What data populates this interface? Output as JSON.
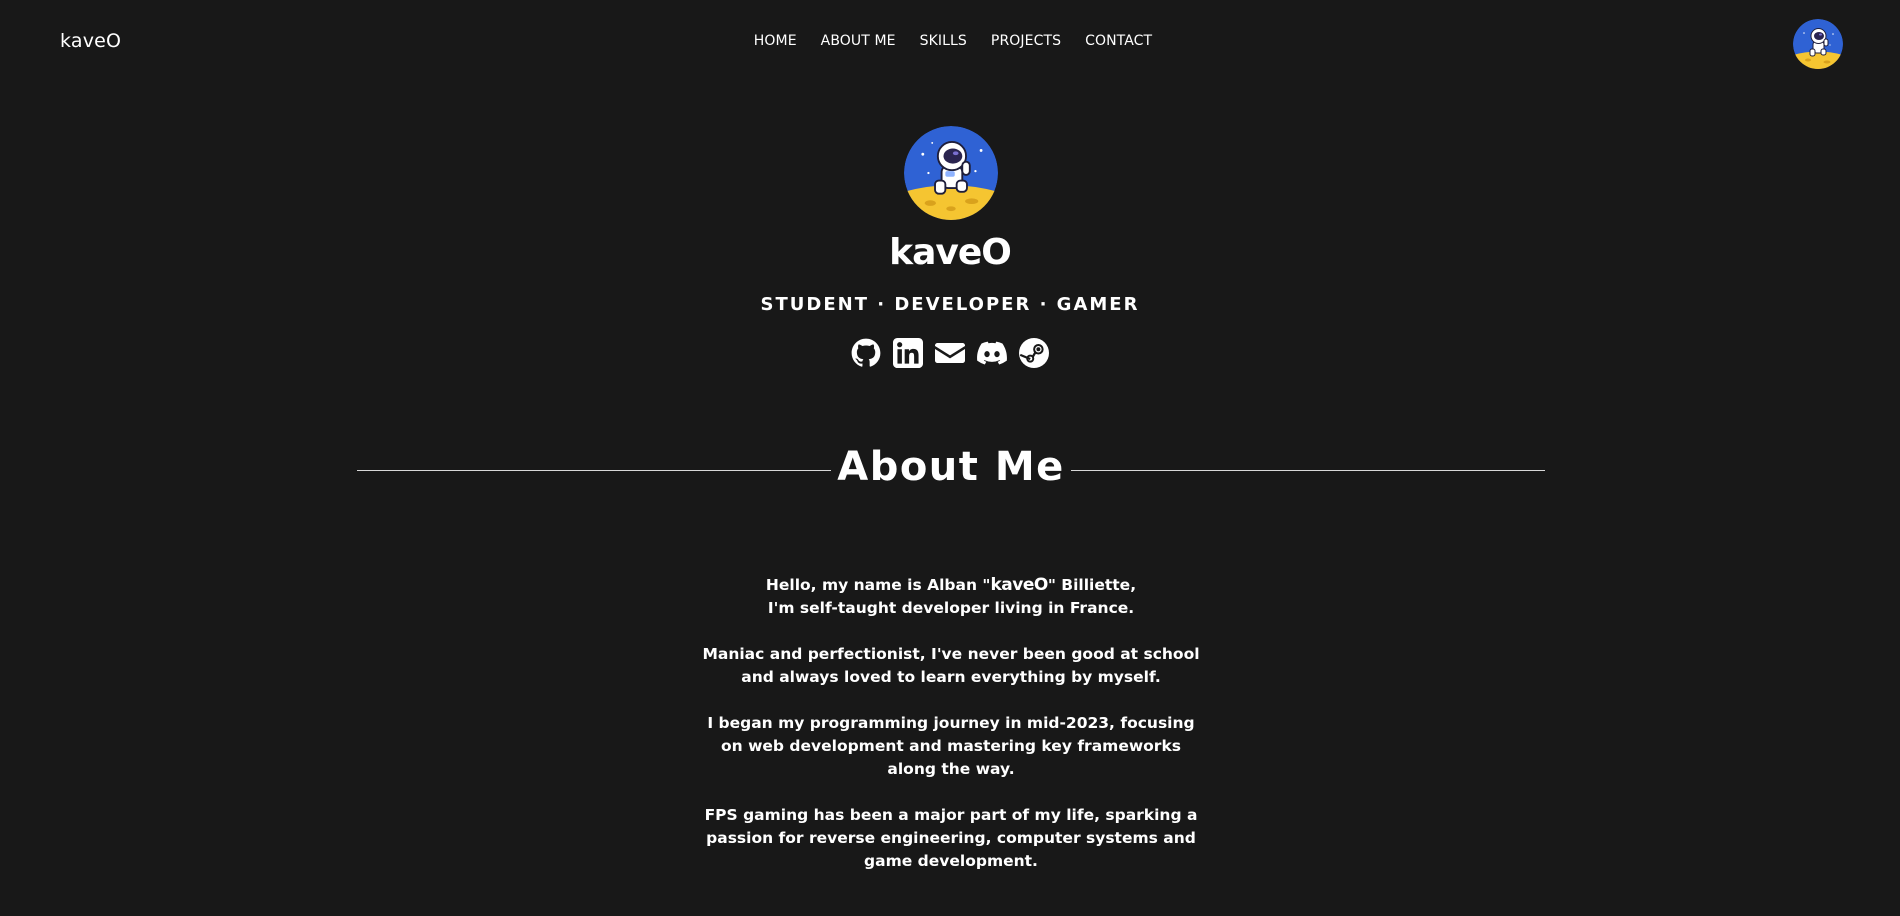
{
  "header": {
    "brand": "kaveO",
    "nav": [
      "HOME",
      "ABOUT ME",
      "SKILLS",
      "PROJECTS",
      "CONTACT"
    ],
    "avatar_icon": "astronaut-avatar-icon"
  },
  "hero": {
    "name": "kaveO",
    "tagline": "STUDENT · DEVELOPER · GAMER",
    "socials": [
      "github-icon",
      "linkedin-icon",
      "email-icon",
      "discord-icon",
      "steam-icon"
    ]
  },
  "about": {
    "title": "About Me",
    "p1_before": "Hello, my name is Alban \"",
    "p1_nick": "kaveO",
    "p1_after": "\" Billiette,",
    "p1_line2": "I'm self-taught developer living in France.",
    "p2": "Maniac and perfectionist, I've never been good at school and always loved to learn everything by myself.",
    "p3": "I began my programming journey in mid-2023, focusing on web development and mastering key frameworks along the way.",
    "p4": "FPS gaming has been a major part of my life, sparking a passion for reverse engineering, computer systems and game development."
  },
  "colors": {
    "background": "#181818",
    "text": "#ffffff",
    "avatar_blue": "#2f62d4",
    "avatar_moon": "#f5c531"
  }
}
